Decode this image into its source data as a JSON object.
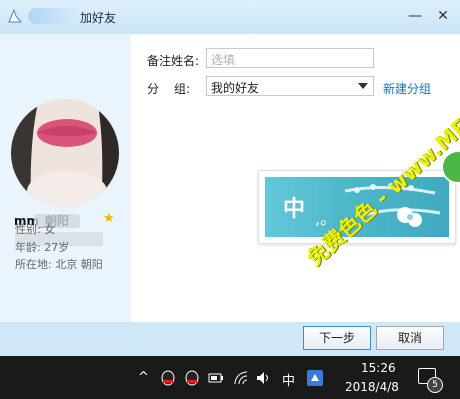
{
  "window": {
    "title": "加好友",
    "min_glyph": "—",
    "close_glyph": "✕"
  },
  "profile": {
    "name": "mm_朝阳",
    "gender": "性别: 女",
    "age": "年龄: 27岁",
    "location": "所在地: 北京  朝阳"
  },
  "form": {
    "remark_label": "备注姓名:",
    "remark_placeholder": "选填",
    "group_label_1": "分",
    "group_label_2": "组:",
    "group_value": "我的好友",
    "new_group_link": "新建分组"
  },
  "popup": {
    "char": "中",
    "dot": ",。"
  },
  "buttons": {
    "next": "下一步",
    "cancel": "取消"
  },
  "taskbar": {
    "chevron": "^",
    "ime": "中",
    "time": "15:26",
    "date": "2018/4/8",
    "badge": "5"
  },
  "watermark": "免费色色 - www.MFsese.com",
  "colors": {
    "accent": "#1a6fc4",
    "title_bar": "#dff0fb",
    "left_panel": "#eaf4fc",
    "taskbar": "#1a1a1a",
    "watermark": "#e8f208"
  }
}
